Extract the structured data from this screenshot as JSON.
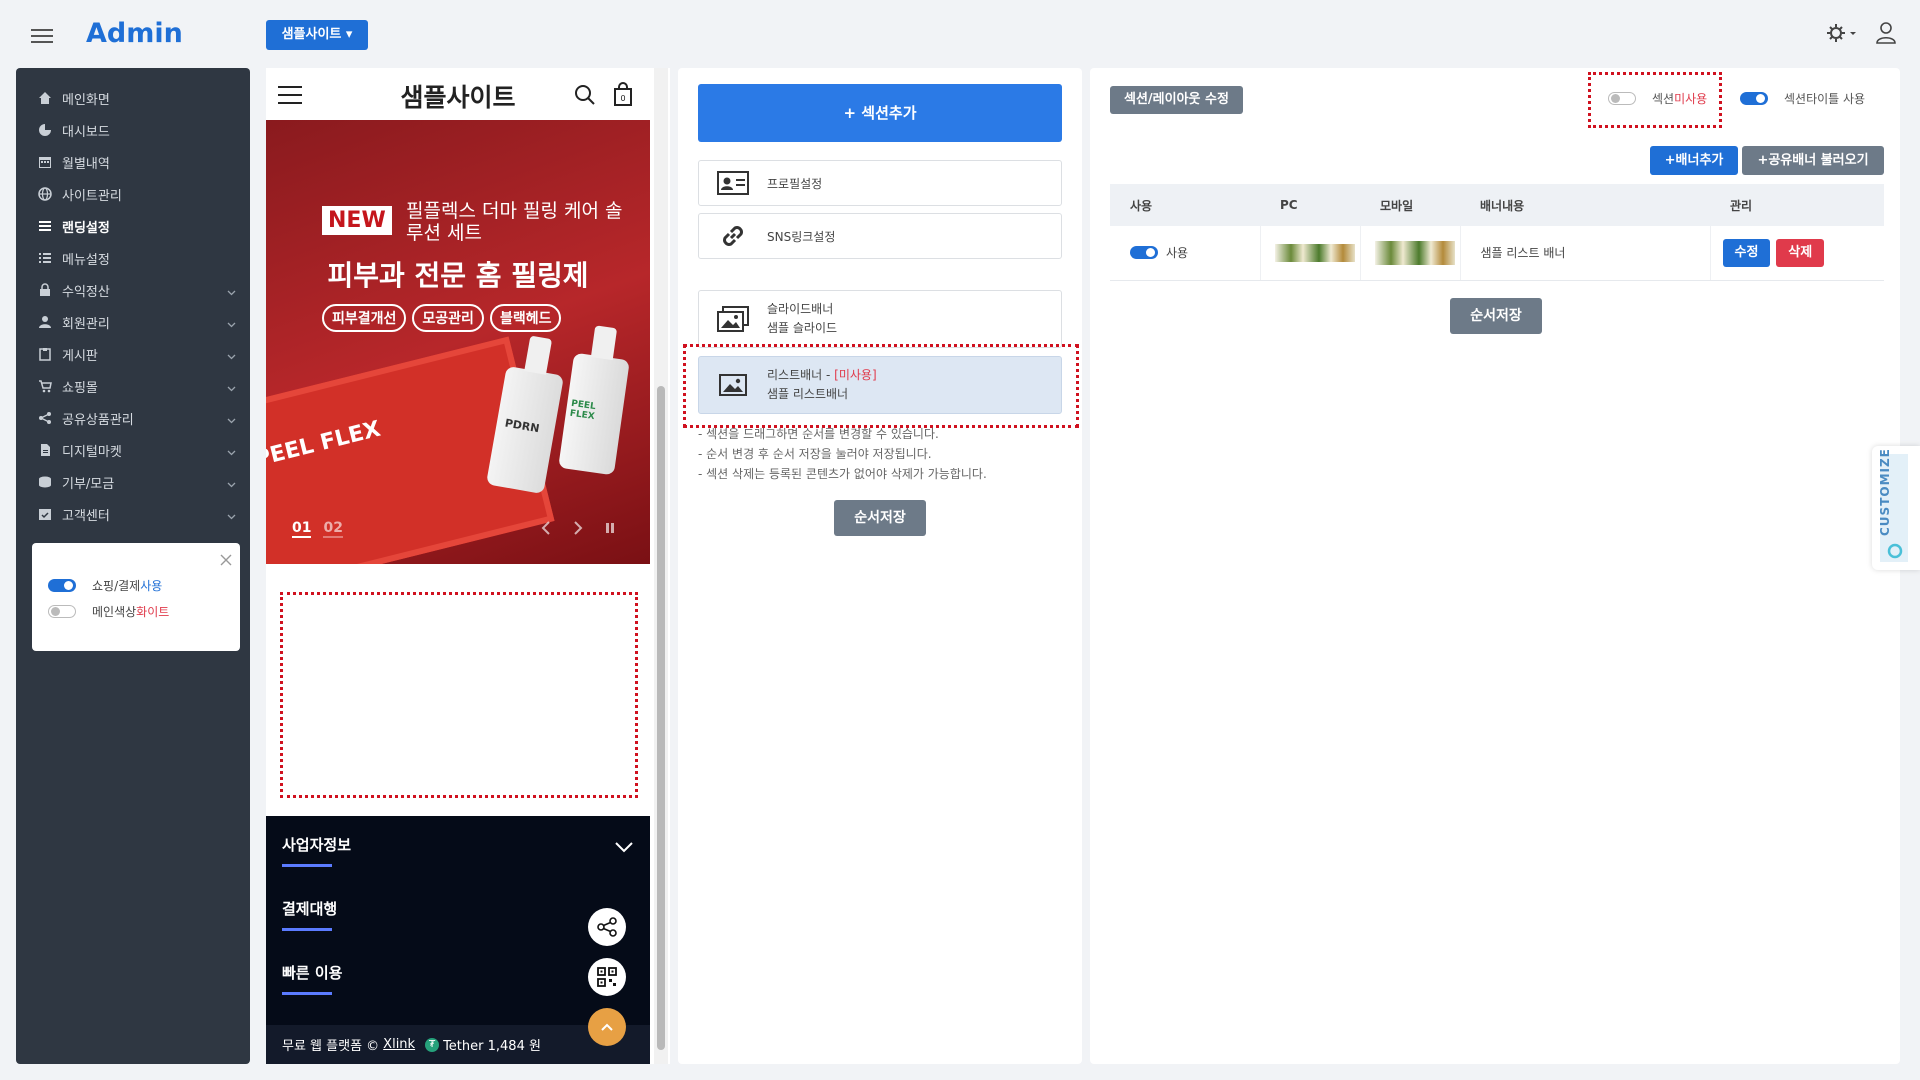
{
  "header": {
    "logo": "Admin",
    "site_select": "샘플사이트 ▾"
  },
  "sidebar": {
    "items": [
      {
        "label": "메인화면",
        "icon": "home-icon"
      },
      {
        "label": "대시보드",
        "icon": "pie-chart-icon"
      },
      {
        "label": "월별내역",
        "icon": "calendar-icon"
      },
      {
        "label": "사이트관리",
        "icon": "globe-icon"
      },
      {
        "label": "랜딩설정",
        "icon": "list-icon"
      },
      {
        "label": "메뉴설정",
        "icon": "menu-list-icon"
      },
      {
        "label": "수익정산",
        "icon": "lock-icon"
      },
      {
        "label": "회원관리",
        "icon": "user-icon"
      },
      {
        "label": "게시판",
        "icon": "clipboard-icon"
      },
      {
        "label": "쇼핑몰",
        "icon": "cart-icon"
      },
      {
        "label": "공유상품관리",
        "icon": "share-icon"
      },
      {
        "label": "디지털마켓",
        "icon": "file-icon"
      },
      {
        "label": "기부/모금",
        "icon": "database-icon"
      },
      {
        "label": "고객센터",
        "icon": "calendar-check-icon"
      }
    ],
    "card": {
      "shopping_prefix": "쇼핑/결제 ",
      "shopping_value": "사용",
      "color_prefix": "메인색상 ",
      "color_value": "화이트"
    }
  },
  "preview": {
    "site_title": "샘플사이트",
    "banner": {
      "new_badge": "NEW",
      "subtitle": "필플렉스 더마 필링 케어 솔루션 세트",
      "title": "피부과 전문 홈 필링제",
      "tags": [
        "피부결개선",
        "모공관리",
        "블랙헤드"
      ],
      "box_text": "PEEL FLEX",
      "bottle1": "PDRN",
      "bottle2": "PEEL FLEX",
      "page_current": "01",
      "page_next": "02"
    },
    "footer": {
      "items": [
        "사업자정보",
        "결제대행",
        "빠른 이용"
      ],
      "bottom_text": "무료 웹 플랫폼 ©",
      "bottom_link": "Xlink",
      "tether_text": "Tether 1,484 원"
    }
  },
  "sections": {
    "add_label": "+ 섹션추가",
    "items": [
      {
        "line1": "프로필설정",
        "icon": "profile-card-icon"
      },
      {
        "line1": "SNS링크설정",
        "icon": "link-icon"
      },
      {
        "line1": "슬라이드배너",
        "line2": "샘플 슬라이드",
        "icon": "images-icon"
      },
      {
        "line1": "리스트배너 - ",
        "tag": "[미사용]",
        "line2": "샘플 리스트배너",
        "icon": "image-icon"
      }
    ],
    "notes": [
      "- 섹션을 드래그하면 순서를 변경할 수 있습니다.",
      "- 순서 변경 후 순서 저장을 눌러야 저장됩니다.",
      "- 섹션 삭제는 등록된 콘텐츠가 없어야 삭제가 가능합니다."
    ],
    "order_save": "순서저장"
  },
  "banners": {
    "layout_btn": "섹션/레이아웃 수정",
    "toggle_section_prefix": "섹션 ",
    "toggle_section_value": "미사용",
    "toggle_title": "섹션타이틀 사용",
    "add_banner": "+배너추가",
    "load_shared": "+공유배너 불러오기",
    "columns": [
      "사용",
      "PC",
      "모바일",
      "배너내용",
      "관리"
    ],
    "row": {
      "use": "사용",
      "content": "샘플 리스트 배너",
      "edit": "수정",
      "delete": "삭제"
    },
    "order_save": "순서저장"
  },
  "customize": "CUSTOMIZE",
  "colors": {
    "accent": "#1f6fd6",
    "sidebar_bg": "#2f3742",
    "danger": "#e03a4b",
    "gray_button": "#6d7a88"
  }
}
